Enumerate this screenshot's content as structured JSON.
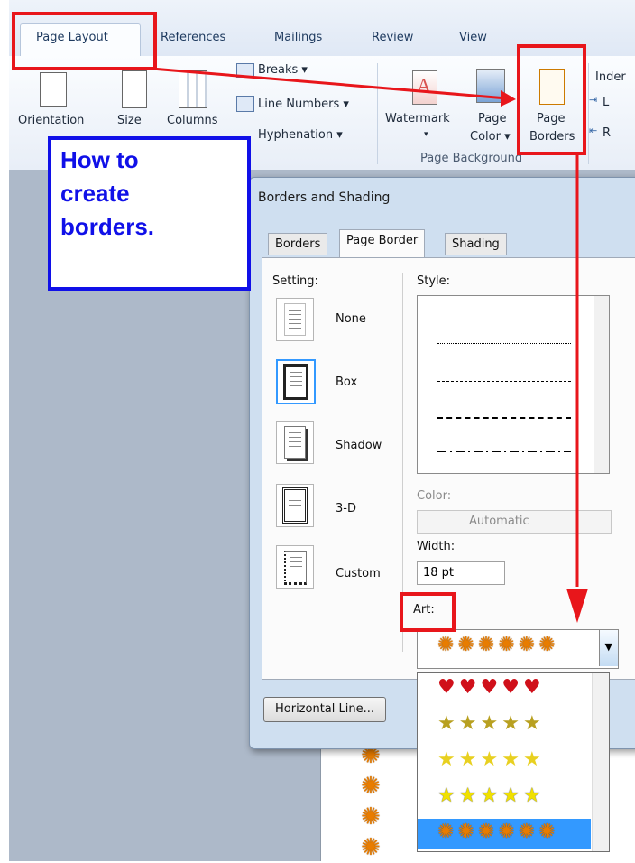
{
  "ribbon": {
    "tabs": [
      "Page Layout",
      "References",
      "Mailings",
      "Review",
      "View"
    ],
    "orientation": "Orientation",
    "size": "Size",
    "columns": "Columns",
    "breaks": "Breaks ▾",
    "line_numbers": "Line Numbers ▾",
    "hyphenation": "Hyphenation ▾",
    "watermark": "Watermark",
    "watermark_caret": "▾",
    "page_color_1": "Page",
    "page_color_2": "Color ▾",
    "page_borders_1": "Page",
    "page_borders_2": "Borders",
    "page_background": "Page Background",
    "indent_cut": "Inder",
    "indent_l": "L",
    "indent_r": "R"
  },
  "callout": {
    "text": "How to\ncreate\nborders."
  },
  "dialog": {
    "title": "Borders and Shading",
    "tabs": [
      "Borders",
      "Page Border",
      "Shading"
    ],
    "setting_label": "Setting:",
    "settings": [
      "None",
      "Box",
      "Shadow",
      "3-D",
      "Custom"
    ],
    "style_label": "Style:",
    "color_label": "Color:",
    "color_value": "Automatic",
    "width_label": "Width:",
    "width_value": "18 pt",
    "art_label": "Art:",
    "horizontal_line_button": "Horizontal Line..."
  },
  "colors": {
    "accent_red": "#e8161b",
    "callout_blue": "#1010e8"
  }
}
